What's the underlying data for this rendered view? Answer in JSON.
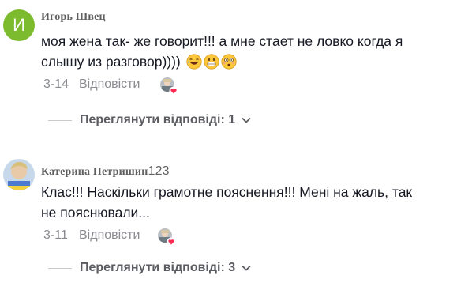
{
  "comments": [
    {
      "avatar_letter": "И",
      "username": "Игорь Швец",
      "text_line1": "моя жена так- же говорит!!! а мне стает не ловко когда я",
      "text_line2": "слышу из разговор))))",
      "date": "3-14",
      "reply_label": "Відповісти",
      "view_replies_label": "Переглянути відповіді: 1"
    },
    {
      "username_name": "Катерина Петришин",
      "username_digits": "123",
      "text_line1": "Клас!!! Наскільки грамотне пояснення!!! Мені на жаль, так",
      "text_line2": "не пояснювали...",
      "date": "3-11",
      "reply_label": "Відповісти",
      "view_replies_label": "Переглянути відповіді: 3"
    }
  ],
  "colors": {
    "avatar_green": "#7cbb2e",
    "like_heart": "#fe2c55",
    "meta_gray": "#8a8b91"
  },
  "icons": [
    "laughing-emoji-icon",
    "grinning-emoji-icon",
    "flushed-emoji-icon",
    "creator-liked-heart-icon",
    "chevron-down-icon"
  ]
}
